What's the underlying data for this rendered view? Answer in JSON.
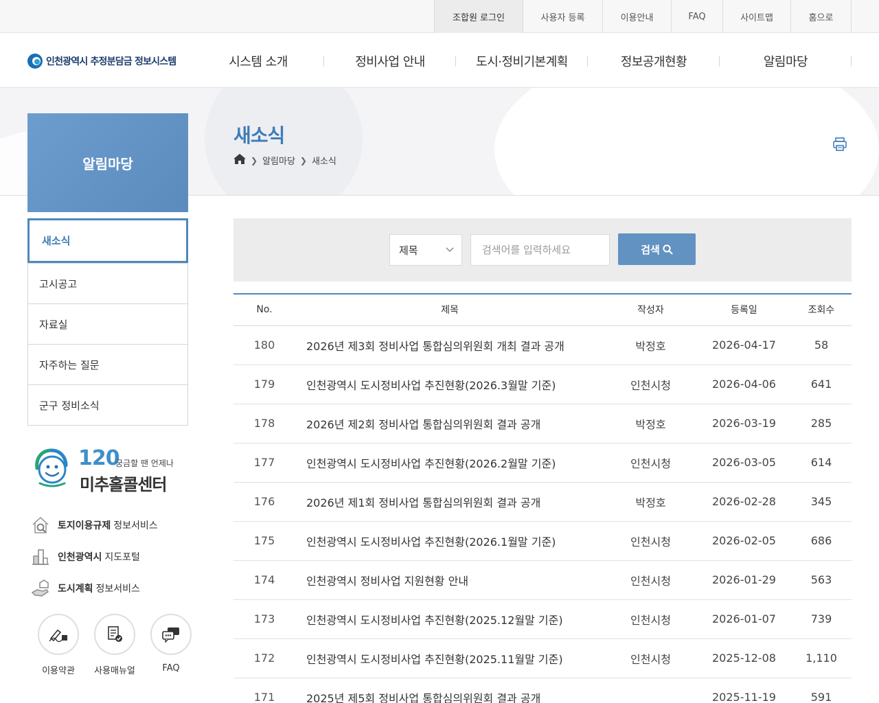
{
  "topbar": {
    "items": [
      "조합원 로그인",
      "사용자 등록",
      "이용안내",
      "FAQ",
      "사이트맵",
      "홈으로"
    ]
  },
  "header": {
    "logo_text": "인천광역시 추정분담금 정보시스템",
    "nav": [
      "시스템 소개",
      "정비사업 안내",
      "도시·정비기본계획",
      "정보공개현황",
      "알림마당"
    ]
  },
  "sidebar": {
    "section_title": "알림마당",
    "items": [
      "새소식",
      "고시공고",
      "자료실",
      "자주하는 질문",
      "군구 정비소식"
    ],
    "active_index": 0,
    "callcenter": {
      "number": "120",
      "tagline": "궁금할 땐 언제나",
      "name": "미추홀콜센터"
    },
    "links": [
      {
        "bold": "토지이용규제",
        "rest": "정보서비스",
        "icon": "house-search-icon"
      },
      {
        "bold": "인천광역시",
        "rest": "지도포털",
        "icon": "building-icon"
      },
      {
        "bold": "도시계획",
        "rest": "정보서비스",
        "icon": "hand-house-icon"
      }
    ],
    "quick": [
      {
        "label": "이용약관",
        "icon": "pen-sign-icon"
      },
      {
        "label": "사용매뉴얼",
        "icon": "manual-check-icon"
      },
      {
        "label": "FAQ",
        "icon": "chat-bubble-icon"
      }
    ]
  },
  "page": {
    "title": "새소식",
    "breadcrumb": [
      "알림마당",
      "새소식"
    ]
  },
  "search": {
    "select_value": "제목",
    "placeholder": "검색어를 입력하세요",
    "button_label": "검색"
  },
  "table": {
    "columns": [
      "No.",
      "제목",
      "작성자",
      "등록일",
      "조회수"
    ],
    "rows": [
      [
        "180",
        "2026년 제3회 정비사업 통합심의위원회 개최 결과 공개",
        "박정호",
        "2026-04-17",
        "58"
      ],
      [
        "179",
        "인천광역시 도시정비사업 추진현황(2026.3월말 기준)",
        "인천시청",
        "2026-04-06",
        "641"
      ],
      [
        "178",
        "2026년 제2회 정비사업 통합심의위원회 결과 공개",
        "박정호",
        "2026-03-19",
        "285"
      ],
      [
        "177",
        "인천광역시 도시정비사업 추진현황(2026.2월말 기준)",
        "인천시청",
        "2026-03-05",
        "614"
      ],
      [
        "176",
        "2026년 제1회 정비사업 통합심의위원회 결과 공개",
        "박정호",
        "2026-02-28",
        "345"
      ],
      [
        "175",
        "인천광역시 도시정비사업 추진현황(2026.1월말 기준)",
        "인천시청",
        "2026-02-05",
        "686"
      ],
      [
        "174",
        "인천광역시 정비사업 지원현황 안내",
        "인천시청",
        "2026-01-29",
        "563"
      ],
      [
        "173",
        "인천광역시 도시정비사업 추진현황(2025.12월말 기준)",
        "인천시청",
        "2026-01-07",
        "739"
      ],
      [
        "172",
        "인천광역시 도시정비사업 추진현황(2025.11월말 기준)",
        "인천시청",
        "2025-12-08",
        "1,110"
      ],
      [
        "171",
        "2025년 제5회 정비사업 통합심의위원회 결과 공개",
        "",
        "2025-11-19",
        "591"
      ]
    ]
  },
  "colors": {
    "accent": "#4f86bd",
    "title_blue": "#3f7bb8",
    "search_button": "#6192c2"
  }
}
